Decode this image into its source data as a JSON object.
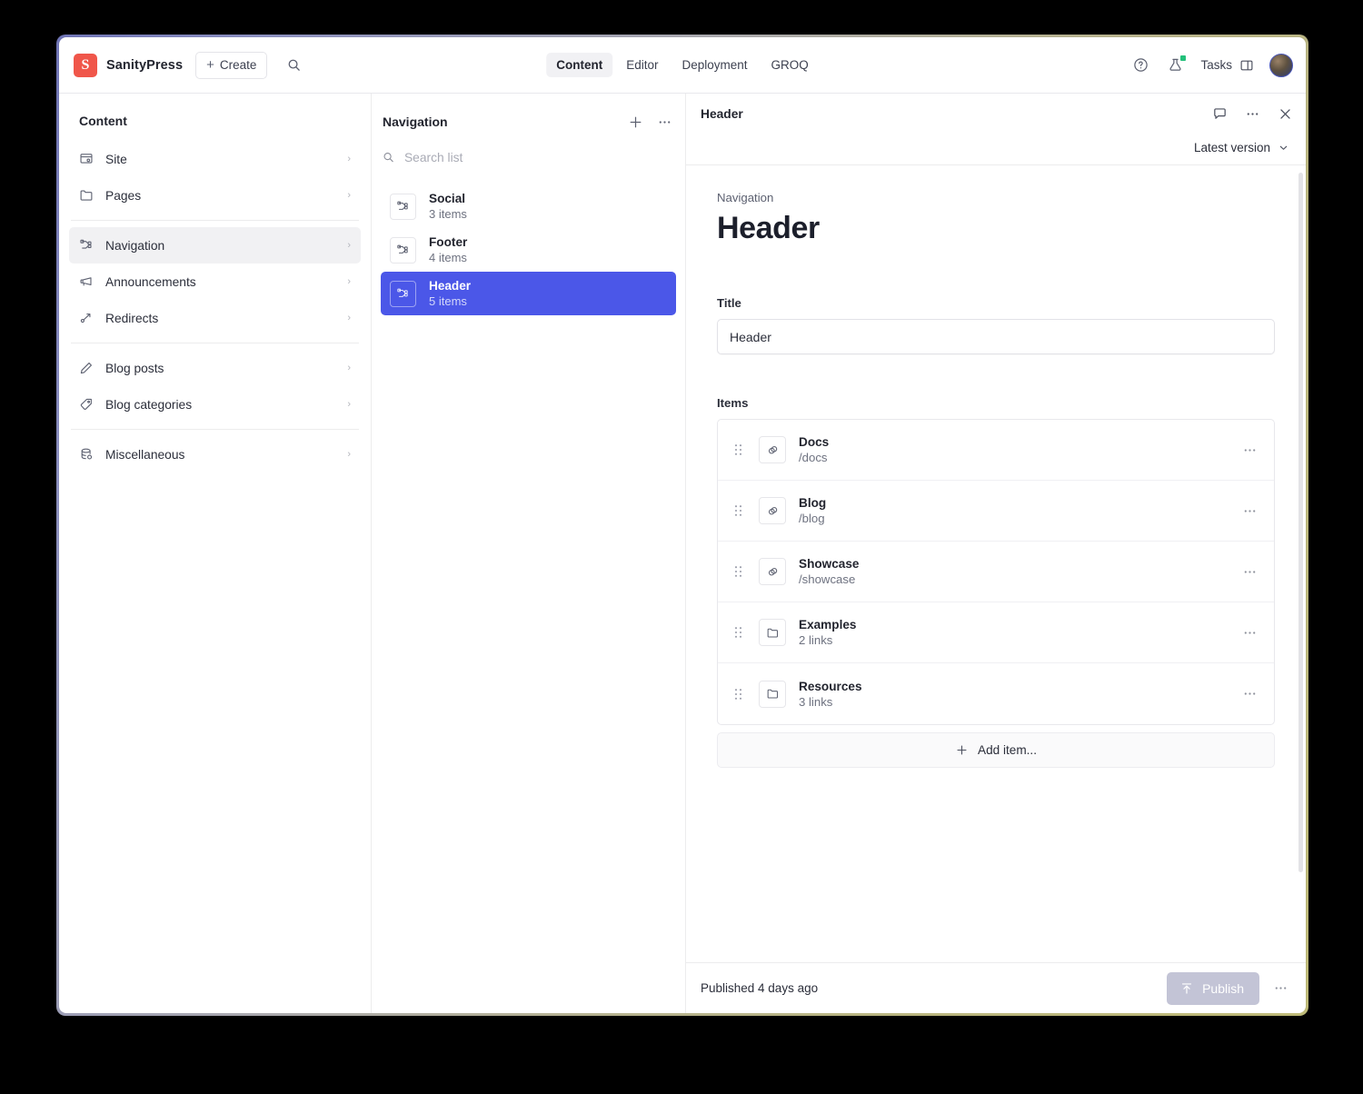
{
  "topbar": {
    "brand": "SanityPress",
    "create_label": "Create",
    "tabs": [
      {
        "label": "Content",
        "active": true
      },
      {
        "label": "Editor",
        "active": false
      },
      {
        "label": "Deployment",
        "active": false
      },
      {
        "label": "GROQ",
        "active": false
      }
    ],
    "tasks_label": "Tasks",
    "icons": {
      "help": "help-circle-icon",
      "lab": "flask-icon",
      "search": "search-icon",
      "panel": "panel-layout-icon",
      "avatar": "user-avatar"
    }
  },
  "structure": {
    "title": "Content",
    "items": [
      {
        "label": "Site",
        "icon": "site-settings-icon",
        "active": false,
        "sep_after": false
      },
      {
        "label": "Pages",
        "icon": "folder-icon",
        "active": false,
        "sep_after": true
      },
      {
        "label": "Navigation",
        "icon": "branch-icon",
        "active": true,
        "sep_after": false
      },
      {
        "label": "Announcements",
        "icon": "megaphone-icon",
        "active": false,
        "sep_after": false
      },
      {
        "label": "Redirects",
        "icon": "redirect-arrow-icon",
        "active": false,
        "sep_after": true
      },
      {
        "label": "Blog posts",
        "icon": "pencil-icon",
        "active": false,
        "sep_after": false
      },
      {
        "label": "Blog categories",
        "icon": "tag-icon",
        "active": false,
        "sep_after": true
      },
      {
        "label": "Miscellaneous",
        "icon": "database-icon",
        "active": false,
        "sep_after": false
      }
    ]
  },
  "list": {
    "title": "Navigation",
    "add_label": "+",
    "menu_label": "…",
    "search_placeholder": "Search list",
    "search_value": "",
    "documents": [
      {
        "name": "Social",
        "sub": "3 items",
        "icon": "branch-icon",
        "selected": false
      },
      {
        "name": "Footer",
        "sub": "4 items",
        "icon": "branch-icon",
        "selected": false
      },
      {
        "name": "Header",
        "sub": "5 items",
        "icon": "branch-icon",
        "selected": true
      }
    ]
  },
  "document": {
    "header_title": "Header",
    "version_label": "Latest version",
    "kicker": "Navigation",
    "title": "Header",
    "fields": {
      "title_label": "Title",
      "title_value": "Header",
      "items_label": "Items"
    },
    "items": [
      {
        "name": "Docs",
        "sub": "/docs",
        "icon": "link-icon"
      },
      {
        "name": "Blog",
        "sub": "/blog",
        "icon": "link-icon"
      },
      {
        "name": "Showcase",
        "sub": "/showcase",
        "icon": "link-icon"
      },
      {
        "name": "Examples",
        "sub": "2 links",
        "icon": "folder-icon"
      },
      {
        "name": "Resources",
        "sub": "3 links",
        "icon": "folder-icon"
      }
    ],
    "add_item_label": "Add item...",
    "footer": {
      "status": "Published 4 days ago",
      "publish_label": "Publish",
      "menu_label": "…"
    }
  },
  "colors": {
    "accent_blue": "#4b57e8",
    "brand_red": "#f0564a",
    "badge_green": "#23c07a",
    "publish_disabled": "#c3c4d6"
  }
}
